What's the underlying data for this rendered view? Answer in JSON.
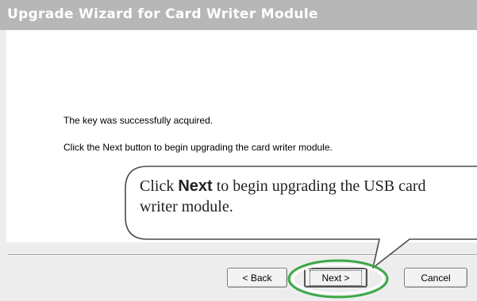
{
  "window": {
    "title": "Upgrade Wizard for Card Writer Module"
  },
  "content": {
    "message_key": "The key was successfully acquired.",
    "message_next": "Click the Next button to begin upgrading the card writer module."
  },
  "buttons": {
    "back": "< Back",
    "next": "Next >",
    "cancel": "Cancel"
  },
  "callout": {
    "prefix": "Click ",
    "bold": "Next",
    "line1_suffix": " to begin upgrading the USB card",
    "line2": "writer module."
  },
  "colors": {
    "titlebar": "#b7b7b7",
    "highlight_ring": "#3aa845"
  }
}
